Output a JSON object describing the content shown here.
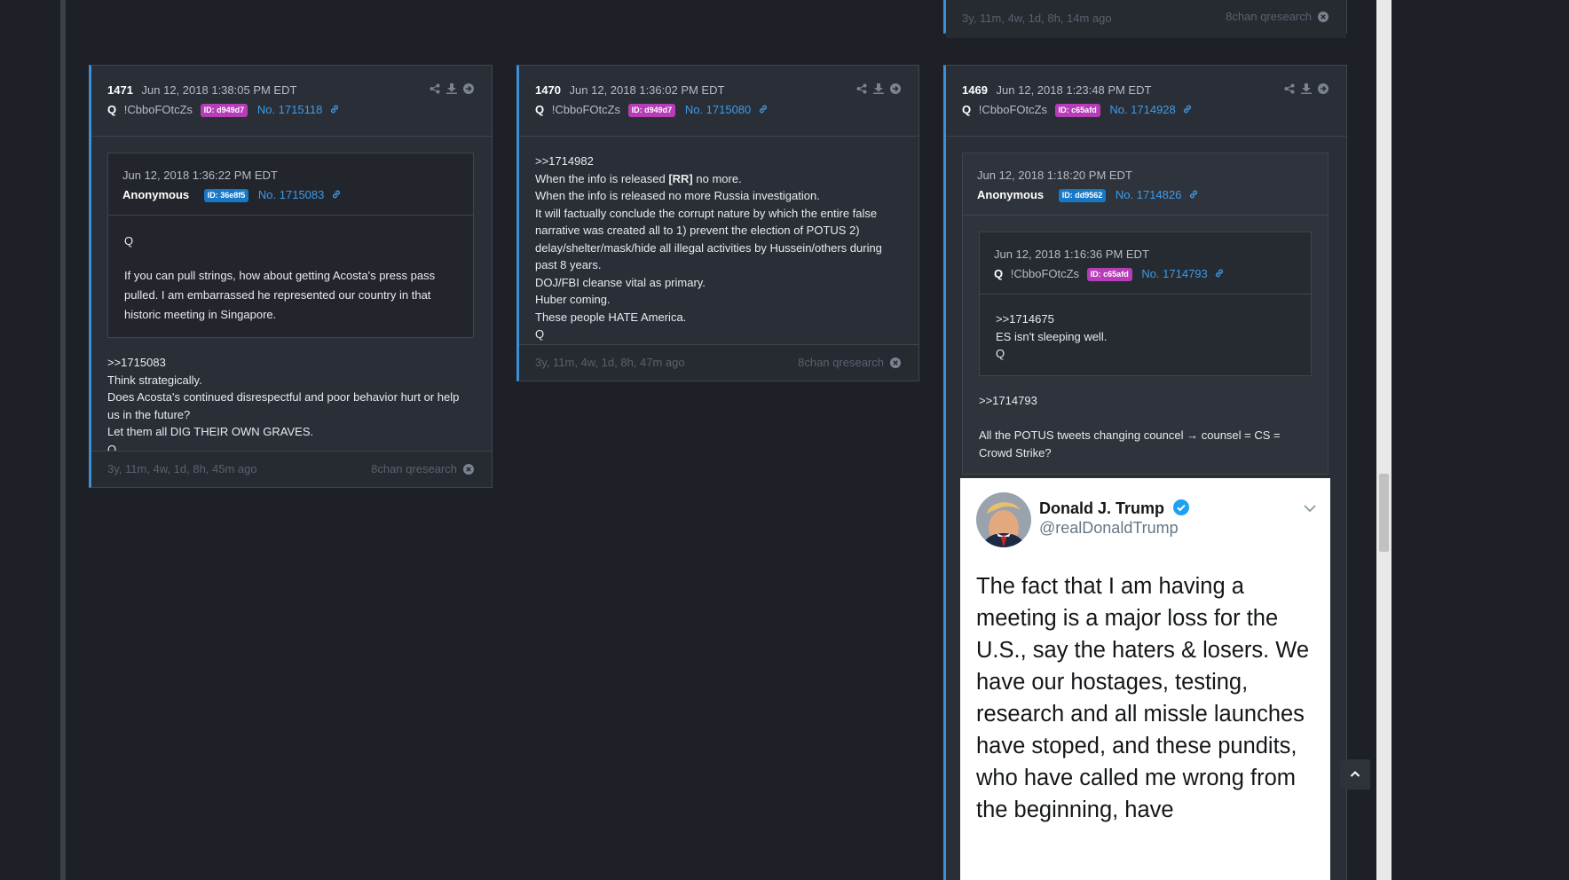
{
  "top_footer": {
    "ago": "3y, 11m, 4w, 1d, 8h, 14m ago",
    "source": "8chan qresearch"
  },
  "posts": [
    {
      "number": "1471",
      "date": "Jun 12, 2018 1:38:05 PM EDT",
      "author": "Q",
      "trip": "!CbboFOtcZs",
      "id": "ID: d949d7",
      "post_no": "No. 1715118",
      "quote": {
        "date": "Jun 12, 2018 1:36:22 PM EDT",
        "author": "Anonymous",
        "id": "ID: 36e8f5",
        "post_no": "No. 1715083",
        "lines": [
          "Q",
          "If you can pull strings, how about getting Acosta's press pass pulled. I am embarrassed he represented our country in that historic meeting in Singapore."
        ]
      },
      "lines": [
        ">>1715083",
        "Think strategically.",
        "Does Acosta's continued disrespectful and poor behavior hurt or help us in the future?",
        "Let them all DIG THEIR OWN GRAVES.",
        "Q"
      ],
      "ago": "3y, 11m, 4w, 1d, 8h, 45m ago",
      "source": "8chan qresearch"
    },
    {
      "number": "1470",
      "date": "Jun 12, 2018 1:36:02 PM EDT",
      "author": "Q",
      "trip": "!CbboFOtcZs",
      "id": "ID: d949d7",
      "post_no": "No. 1715080",
      "lines": [
        ">>1714982",
        "When the info is released",
        "[RR]",
        "no more.",
        "When the info is released no more Russia investigation.",
        "It will factually conclude the corrupt nature by which the entire false narrative was created all to 1) prevent the election of POTUS 2) delay/shelter/mask/hide all illegal activities by Hussein/others during past 8 years.",
        "DOJ/FBI cleanse vital as primary.",
        "Huber coming.",
        "These people HATE America.",
        "Q"
      ],
      "ago": "3y, 11m, 4w, 1d, 8h, 47m ago",
      "source": "8chan qresearch"
    },
    {
      "number": "1469",
      "date": "Jun 12, 2018 1:23:48 PM EDT",
      "author": "Q",
      "trip": "!CbboFOtcZs",
      "id": "ID: c65afd",
      "post_no": "No. 1714928",
      "quote": {
        "date": "Jun 12, 2018 1:18:20 PM EDT",
        "author": "Anonymous",
        "id": "ID: dd9562",
        "post_no": "No. 1714826",
        "inner": {
          "date": "Jun 12, 2018 1:16:36 PM EDT",
          "author": "Q",
          "trip": "!CbboFOtcZs",
          "id": "ID: c65afd",
          "post_no": "No. 1714793",
          "lines": [
            ">>1714675",
            "ES isn't sleeping well.",
            "Q"
          ]
        },
        "lines": [
          ">>1714793",
          "All the POTUS tweets changing councel → counsel = CS = Crowd Strike?"
        ]
      },
      "tweet": {
        "name": "Donald J. Trump",
        "handle": "@realDonaldTrump",
        "text": "The fact that I am having a meeting is a major loss for the U.S., say the haters & losers. We have our hostages, testing, research and all missle launches have stoped, and these pundits, who have called me wrong from the beginning, have"
      }
    }
  ],
  "colors": {
    "background": "#1d2027",
    "card": "#2a2e36",
    "accent": "#3d8fd6",
    "link": "#3d9be9",
    "id_magenta": "#b73db8",
    "id_blue": "#1878c8"
  },
  "icons": [
    "share-icon",
    "download-icon",
    "arrow-right-circle-icon",
    "link-icon",
    "close-circle-icon",
    "verified-icon",
    "chevron-down-icon",
    "chevron-up-icon"
  ]
}
